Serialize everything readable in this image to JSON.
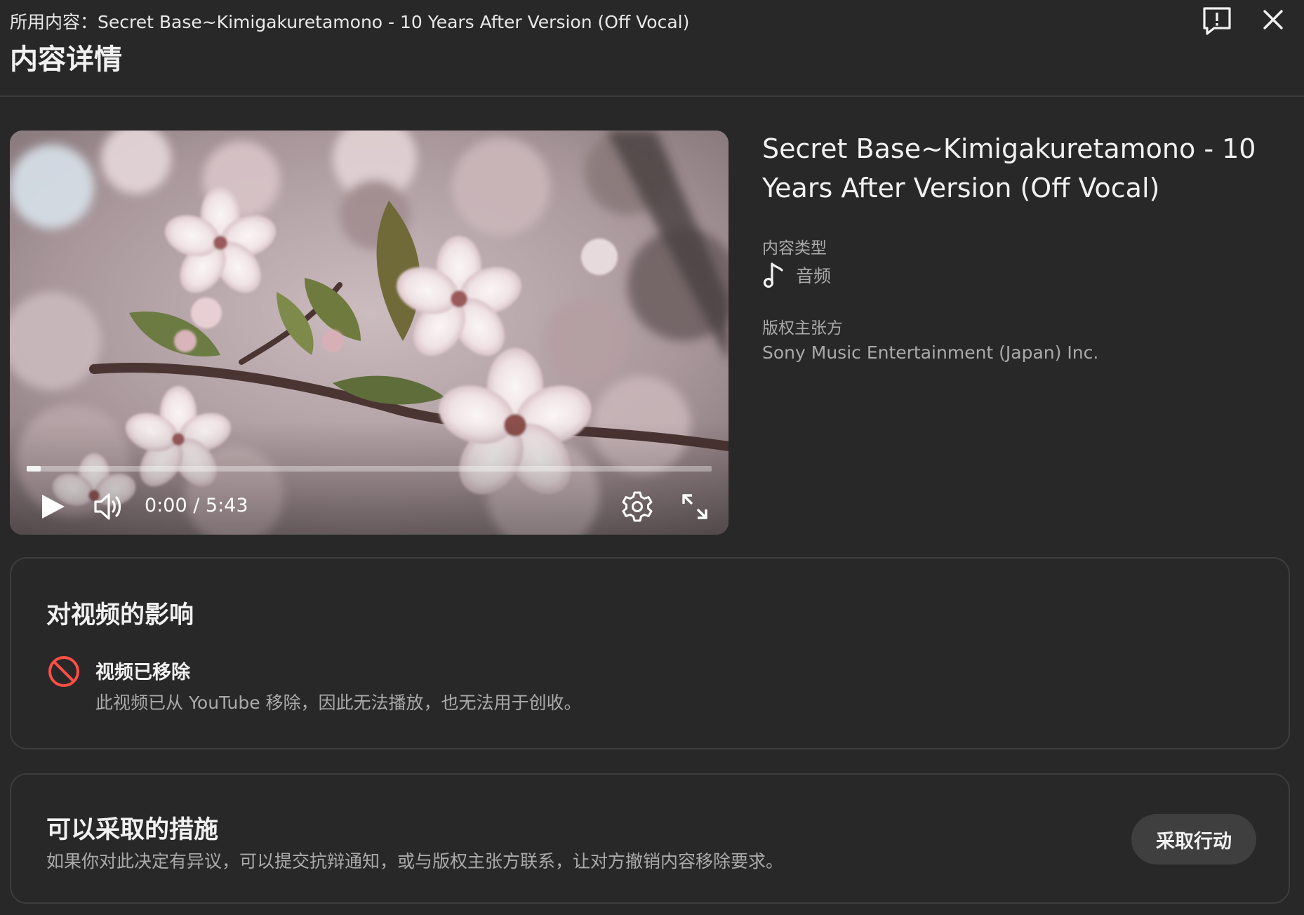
{
  "header": {
    "used_content": "所用内容：Secret Base~Kimigakuretamono - 10 Years After Version (Off Vocal)",
    "title": "内容详情",
    "feedback_icon": "feedback-icon",
    "close_icon": "close-icon"
  },
  "player": {
    "current_time": "0:00",
    "duration": "5:43",
    "time_display": "0:00 / 5:43",
    "progress_fraction": 0.02,
    "icons": [
      "play-icon",
      "volume-icon",
      "settings-gear-icon",
      "fullscreen-icon"
    ]
  },
  "info": {
    "title": "Secret Base~Kimigakuretamono - 10 Years After Version (Off Vocal)",
    "content_type_label": "内容类型",
    "content_type_value": "音频",
    "content_type_icon": "music-note-icon",
    "claimant_label": "版权主张方",
    "claimant_value": "Sony Music Entertainment (Japan) Inc."
  },
  "impact": {
    "title": "对视频的影响",
    "status_icon": "blocked-icon",
    "status_color": "#ff4e45",
    "heading": "视频已移除",
    "description": "此视频已从 YouTube 移除，因此无法播放，也无法用于创收。"
  },
  "actions": {
    "title": "可以采取的措施",
    "description": "如果你对此决定有异议，可以提交抗辩通知，或与版权主张方联系，让对方撤销内容移除要求。",
    "button_label": "采取行动"
  },
  "colors": {
    "background": "#282828",
    "border": "#3d3d3d",
    "text_primary": "#f1f1f1",
    "text_secondary": "#aaaaaa",
    "button_bg": "#3f3f3f"
  }
}
